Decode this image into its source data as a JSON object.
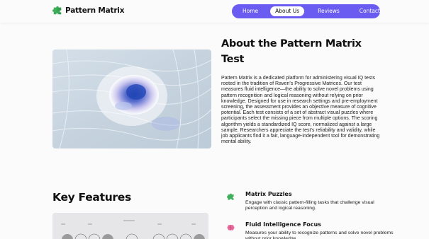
{
  "header": {
    "brand": "Pattern Matrix",
    "logo_icon": "puzzle-icon",
    "nav": [
      {
        "label": "Home",
        "active": false
      },
      {
        "label": "About Us",
        "active": true
      },
      {
        "label": "Reviews",
        "active": false
      },
      {
        "label": "Contact",
        "active": false
      }
    ],
    "accent_color": "#6a5cf0"
  },
  "about": {
    "title": "About the Pattern Matrix Test",
    "body": "Pattern Matrix is a dedicated platform for administering visual IQ tests rooted in the tradition of Raven's Progressive Matrices. Our test measures fluid intelligence—the ability to solve novel problems using pattern recognition and logical reasoning without relying on prior knowledge. Designed for use in research settings and pre-employment screening, the assessment provides an objective measure of cognitive potential. Each test consists of a set of abstract visual puzzles where participants select the missing piece from multiple options. The scoring algorithm yields a standardized IQ score, normalized against a large sample. Researchers appreciate the test's reliability and validity, while job applicants find it a fair, language-independent tool for demonstrating mental ability."
  },
  "key_features": {
    "title": "Key Features",
    "items": [
      {
        "icon": "puzzle-icon",
        "title": "Matrix Puzzles",
        "desc": "Engage with classic pattern-filling tasks that challenge visual perception and logical reasoning."
      },
      {
        "icon": "brain-icon",
        "title": "Fluid Intelligence Focus",
        "desc": "Measures your ability to recognize patterns and solve novel problems without prior knowledge."
      }
    ]
  }
}
